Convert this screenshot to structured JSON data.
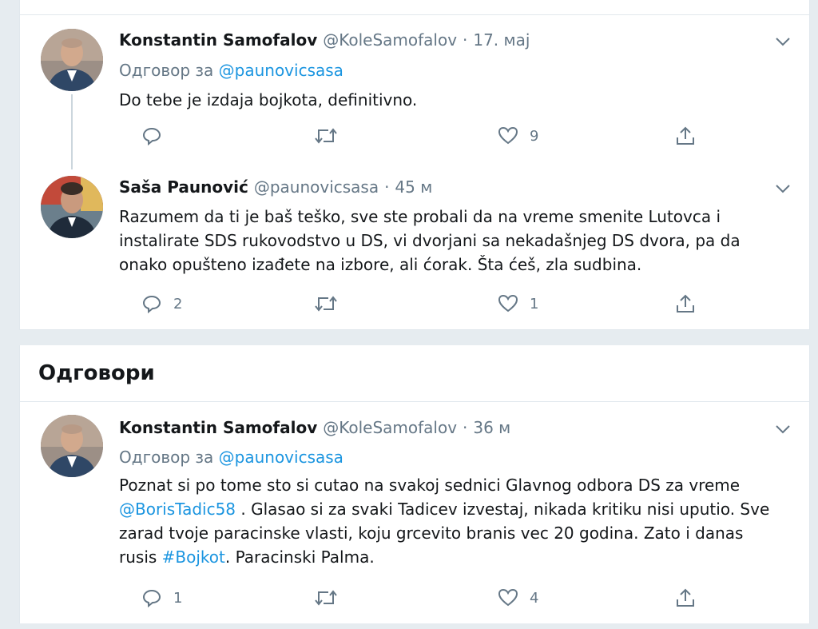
{
  "colors": {
    "link": "#1b95e0",
    "muted": "#657786",
    "text": "#14171a",
    "background": "#e6ecf0"
  },
  "thread": [
    {
      "author_name": "Konstantin Samofalov",
      "handle": "@KoleSamofalov",
      "sep": "·",
      "time": "17. мај",
      "reply_prefix": "Одговор за",
      "reply_to": "@paunovicsasa",
      "text": "Do tebe je izdaja bojkota, definitivno.",
      "replies": "",
      "retweets": "",
      "likes": "9"
    },
    {
      "author_name": "Saša Paunović",
      "handle": "@paunovicsasa",
      "sep": "·",
      "time": "45 м",
      "text": "Razumem da ti je baš teško, sve ste probali da na vreme smenite Lutovca i instalirate SDS rukovodstvo u DS, vi dvorjani sa nekadašnjeg DS dvora, pa da onako opušteno izađete na izbore, ali ćorak. Šta ćeš, zla sudbina.",
      "replies": "2",
      "retweets": "",
      "likes": "1"
    }
  ],
  "replies_section": {
    "title": "Одговори",
    "tweet": {
      "author_name": "Konstantin Samofalov",
      "handle": "@KoleSamofalov",
      "sep": "·",
      "time": "36 м",
      "reply_prefix": "Одговор за",
      "reply_to": "@paunovicsasa",
      "text_part1": "Poznat si po tome sto si cutao na svakoj sednici Glavnog odbora DS za vreme ",
      "mention": "@BorisTadic58",
      "text_part2": " . Glasao si za svaki Tadicev izvestaj, nikada kritiku nisi uputio. Sve zarad tvoje paracinske vlasti, koju grcevito branis vec 20 godina. Zato i danas rusis ",
      "hashtag": "#Bojkot",
      "text_part3": ". Paracinski Palma.",
      "replies": "1",
      "retweets": "",
      "likes": "4"
    }
  },
  "icons": {
    "reply": "reply-icon",
    "retweet": "retweet-icon",
    "like": "heart-icon",
    "share": "share-icon",
    "more": "chevron-down-icon"
  }
}
